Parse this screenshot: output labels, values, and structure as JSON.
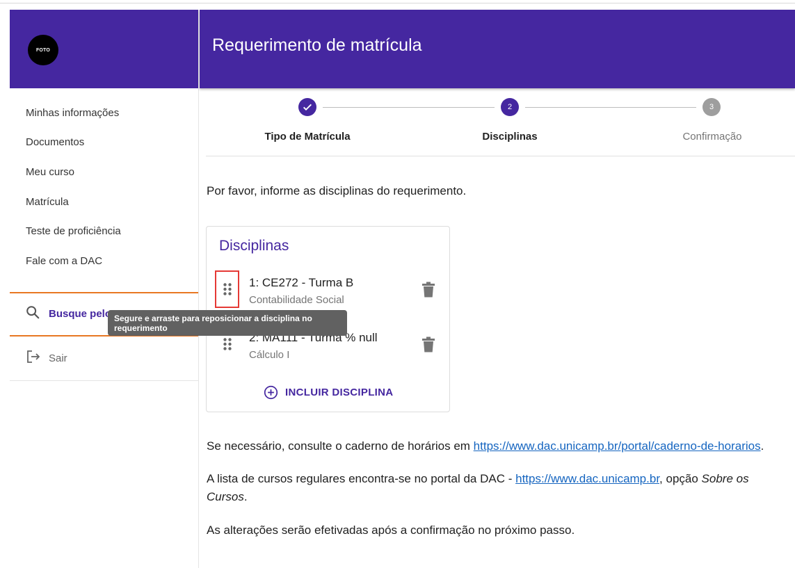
{
  "sidebar": {
    "avatar_text": "FOTO",
    "nav_items": [
      {
        "label": "Minhas informações"
      },
      {
        "label": "Documentos"
      },
      {
        "label": "Meu curso"
      },
      {
        "label": "Matrícula"
      },
      {
        "label": "Teste de proficiência"
      },
      {
        "label": "Fale com a DAC"
      }
    ],
    "search_label": "Busque pelo",
    "logout_label": "Sair"
  },
  "header": {
    "title": "Requerimento de matrícula"
  },
  "stepper": {
    "steps": [
      {
        "number": "1",
        "label": "Tipo de Matrícula",
        "state": "done"
      },
      {
        "number": "2",
        "label": "Disciplinas",
        "state": "active"
      },
      {
        "number": "3",
        "label": "Confirmação",
        "state": "pending"
      }
    ]
  },
  "main": {
    "intro": "Por favor, informe as disciplinas do requerimento.",
    "card_title": "Disciplinas",
    "disciplines": [
      {
        "title": "1: CE272 - Turma B",
        "subtitle": "Contabilidade Social"
      },
      {
        "title": "2: MA111 - Turma % null",
        "subtitle": "Cálculo I"
      }
    ],
    "add_label": "INCLUIR DISCIPLINA",
    "tooltip": "Segure e arraste para reposicionar a disciplina no requerimento",
    "para1_prefix": "Se necessário, consulte o caderno de horários em ",
    "para1_link": "https://www.dac.unicamp.br/portal/caderno-de-horarios",
    "para1_suffix": ".",
    "para2_prefix": "A lista de cursos regulares encontra-se no portal da DAC - ",
    "para2_link": "https://www.dac.unicamp.br",
    "para2_middle": ", opção ",
    "para2_italic": "Sobre os Cursos",
    "para2_suffix": ".",
    "para3": "As alterações serão efetivadas após a confirmação no próximo passo."
  },
  "colors": {
    "primary": "#4527a0",
    "accent_orange": "#e87722",
    "link": "#1565c0",
    "highlight_red": "#e53935"
  },
  "icons": [
    "search-icon",
    "logout-icon",
    "check-icon",
    "drag-handle-icon",
    "trash-icon",
    "add-circle-icon"
  ]
}
